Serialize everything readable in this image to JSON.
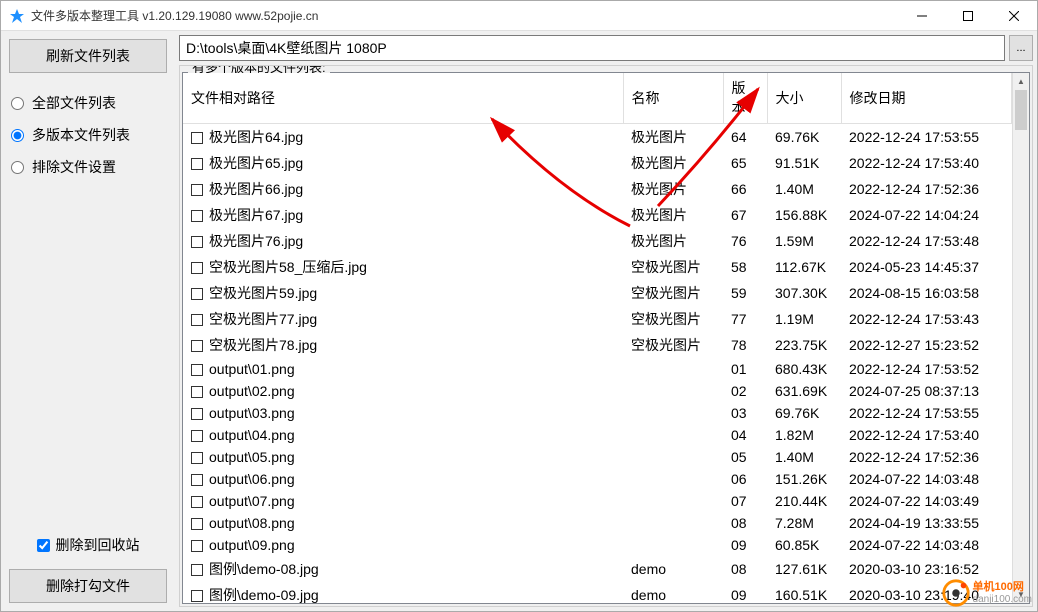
{
  "window": {
    "title": "文件多版本整理工具 v1.20.129.19080 www.52pojie.cn"
  },
  "sidebar": {
    "refreshBtn": "刷新文件列表",
    "radios": [
      {
        "label": "全部文件列表",
        "checked": false
      },
      {
        "label": "多版本文件列表",
        "checked": true
      },
      {
        "label": "排除文件设置",
        "checked": false
      }
    ],
    "deleteToRecycle": {
      "label": "删除到回收站",
      "checked": true
    },
    "deleteCheckedBtn": "删除打勾文件"
  },
  "path": {
    "value": "D:\\tools\\桌面\\4K壁纸图片 1080P",
    "browseBtn": "..."
  },
  "group": {
    "label": "有多个版本的文件列表:"
  },
  "columns": {
    "path": "文件相对路径",
    "name": "名称",
    "ver": "版本",
    "size": "大小",
    "date": "修改日期"
  },
  "rows": [
    {
      "path": "极光图片64.jpg",
      "name": "极光图片",
      "ver": "64",
      "size": "69.76K",
      "date": "2022-12-24 17:53:55"
    },
    {
      "path": "极光图片65.jpg",
      "name": "极光图片",
      "ver": "65",
      "size": "91.51K",
      "date": "2022-12-24 17:53:40"
    },
    {
      "path": "极光图片66.jpg",
      "name": "极光图片",
      "ver": "66",
      "size": "1.40M",
      "date": "2022-12-24 17:52:36"
    },
    {
      "path": "极光图片67.jpg",
      "name": "极光图片",
      "ver": "67",
      "size": "156.88K",
      "date": "2024-07-22 14:04:24"
    },
    {
      "path": "极光图片76.jpg",
      "name": "极光图片",
      "ver": "76",
      "size": "1.59M",
      "date": "2022-12-24 17:53:48"
    },
    {
      "path": "空极光图片58_压缩后.jpg",
      "name": "空极光图片",
      "ver": "58",
      "size": "112.67K",
      "date": "2024-05-23 14:45:37"
    },
    {
      "path": "空极光图片59.jpg",
      "name": "空极光图片",
      "ver": "59",
      "size": "307.30K",
      "date": "2024-08-15 16:03:58"
    },
    {
      "path": "空极光图片77.jpg",
      "name": "空极光图片",
      "ver": "77",
      "size": "1.19M",
      "date": "2022-12-24 17:53:43"
    },
    {
      "path": "空极光图片78.jpg",
      "name": "空极光图片",
      "ver": "78",
      "size": "223.75K",
      "date": "2022-12-27 15:23:52"
    },
    {
      "path": "output\\01.png",
      "name": "",
      "ver": "01",
      "size": "680.43K",
      "date": "2022-12-24 17:53:52"
    },
    {
      "path": "output\\02.png",
      "name": "",
      "ver": "02",
      "size": "631.69K",
      "date": "2024-07-25 08:37:13"
    },
    {
      "path": "output\\03.png",
      "name": "",
      "ver": "03",
      "size": "69.76K",
      "date": "2022-12-24 17:53:55"
    },
    {
      "path": "output\\04.png",
      "name": "",
      "ver": "04",
      "size": "1.82M",
      "date": "2022-12-24 17:53:40"
    },
    {
      "path": "output\\05.png",
      "name": "",
      "ver": "05",
      "size": "1.40M",
      "date": "2022-12-24 17:52:36"
    },
    {
      "path": "output\\06.png",
      "name": "",
      "ver": "06",
      "size": "151.26K",
      "date": "2024-07-22 14:03:48"
    },
    {
      "path": "output\\07.png",
      "name": "",
      "ver": "07",
      "size": "210.44K",
      "date": "2024-07-22 14:03:49"
    },
    {
      "path": "output\\08.png",
      "name": "",
      "ver": "08",
      "size": "7.28M",
      "date": "2024-04-19 13:33:55"
    },
    {
      "path": "output\\09.png",
      "name": "",
      "ver": "09",
      "size": "60.85K",
      "date": "2024-07-22 14:03:48"
    },
    {
      "path": "图例\\demo-08.jpg",
      "name": "demo",
      "ver": "08",
      "size": "127.61K",
      "date": "2020-03-10 23:16:52"
    },
    {
      "path": "图例\\demo-09.jpg",
      "name": "demo",
      "ver": "09",
      "size": "160.51K",
      "date": "2020-03-10 23:19:40"
    }
  ],
  "watermark": {
    "cn": "单机100网",
    "url": "danji100.com"
  }
}
